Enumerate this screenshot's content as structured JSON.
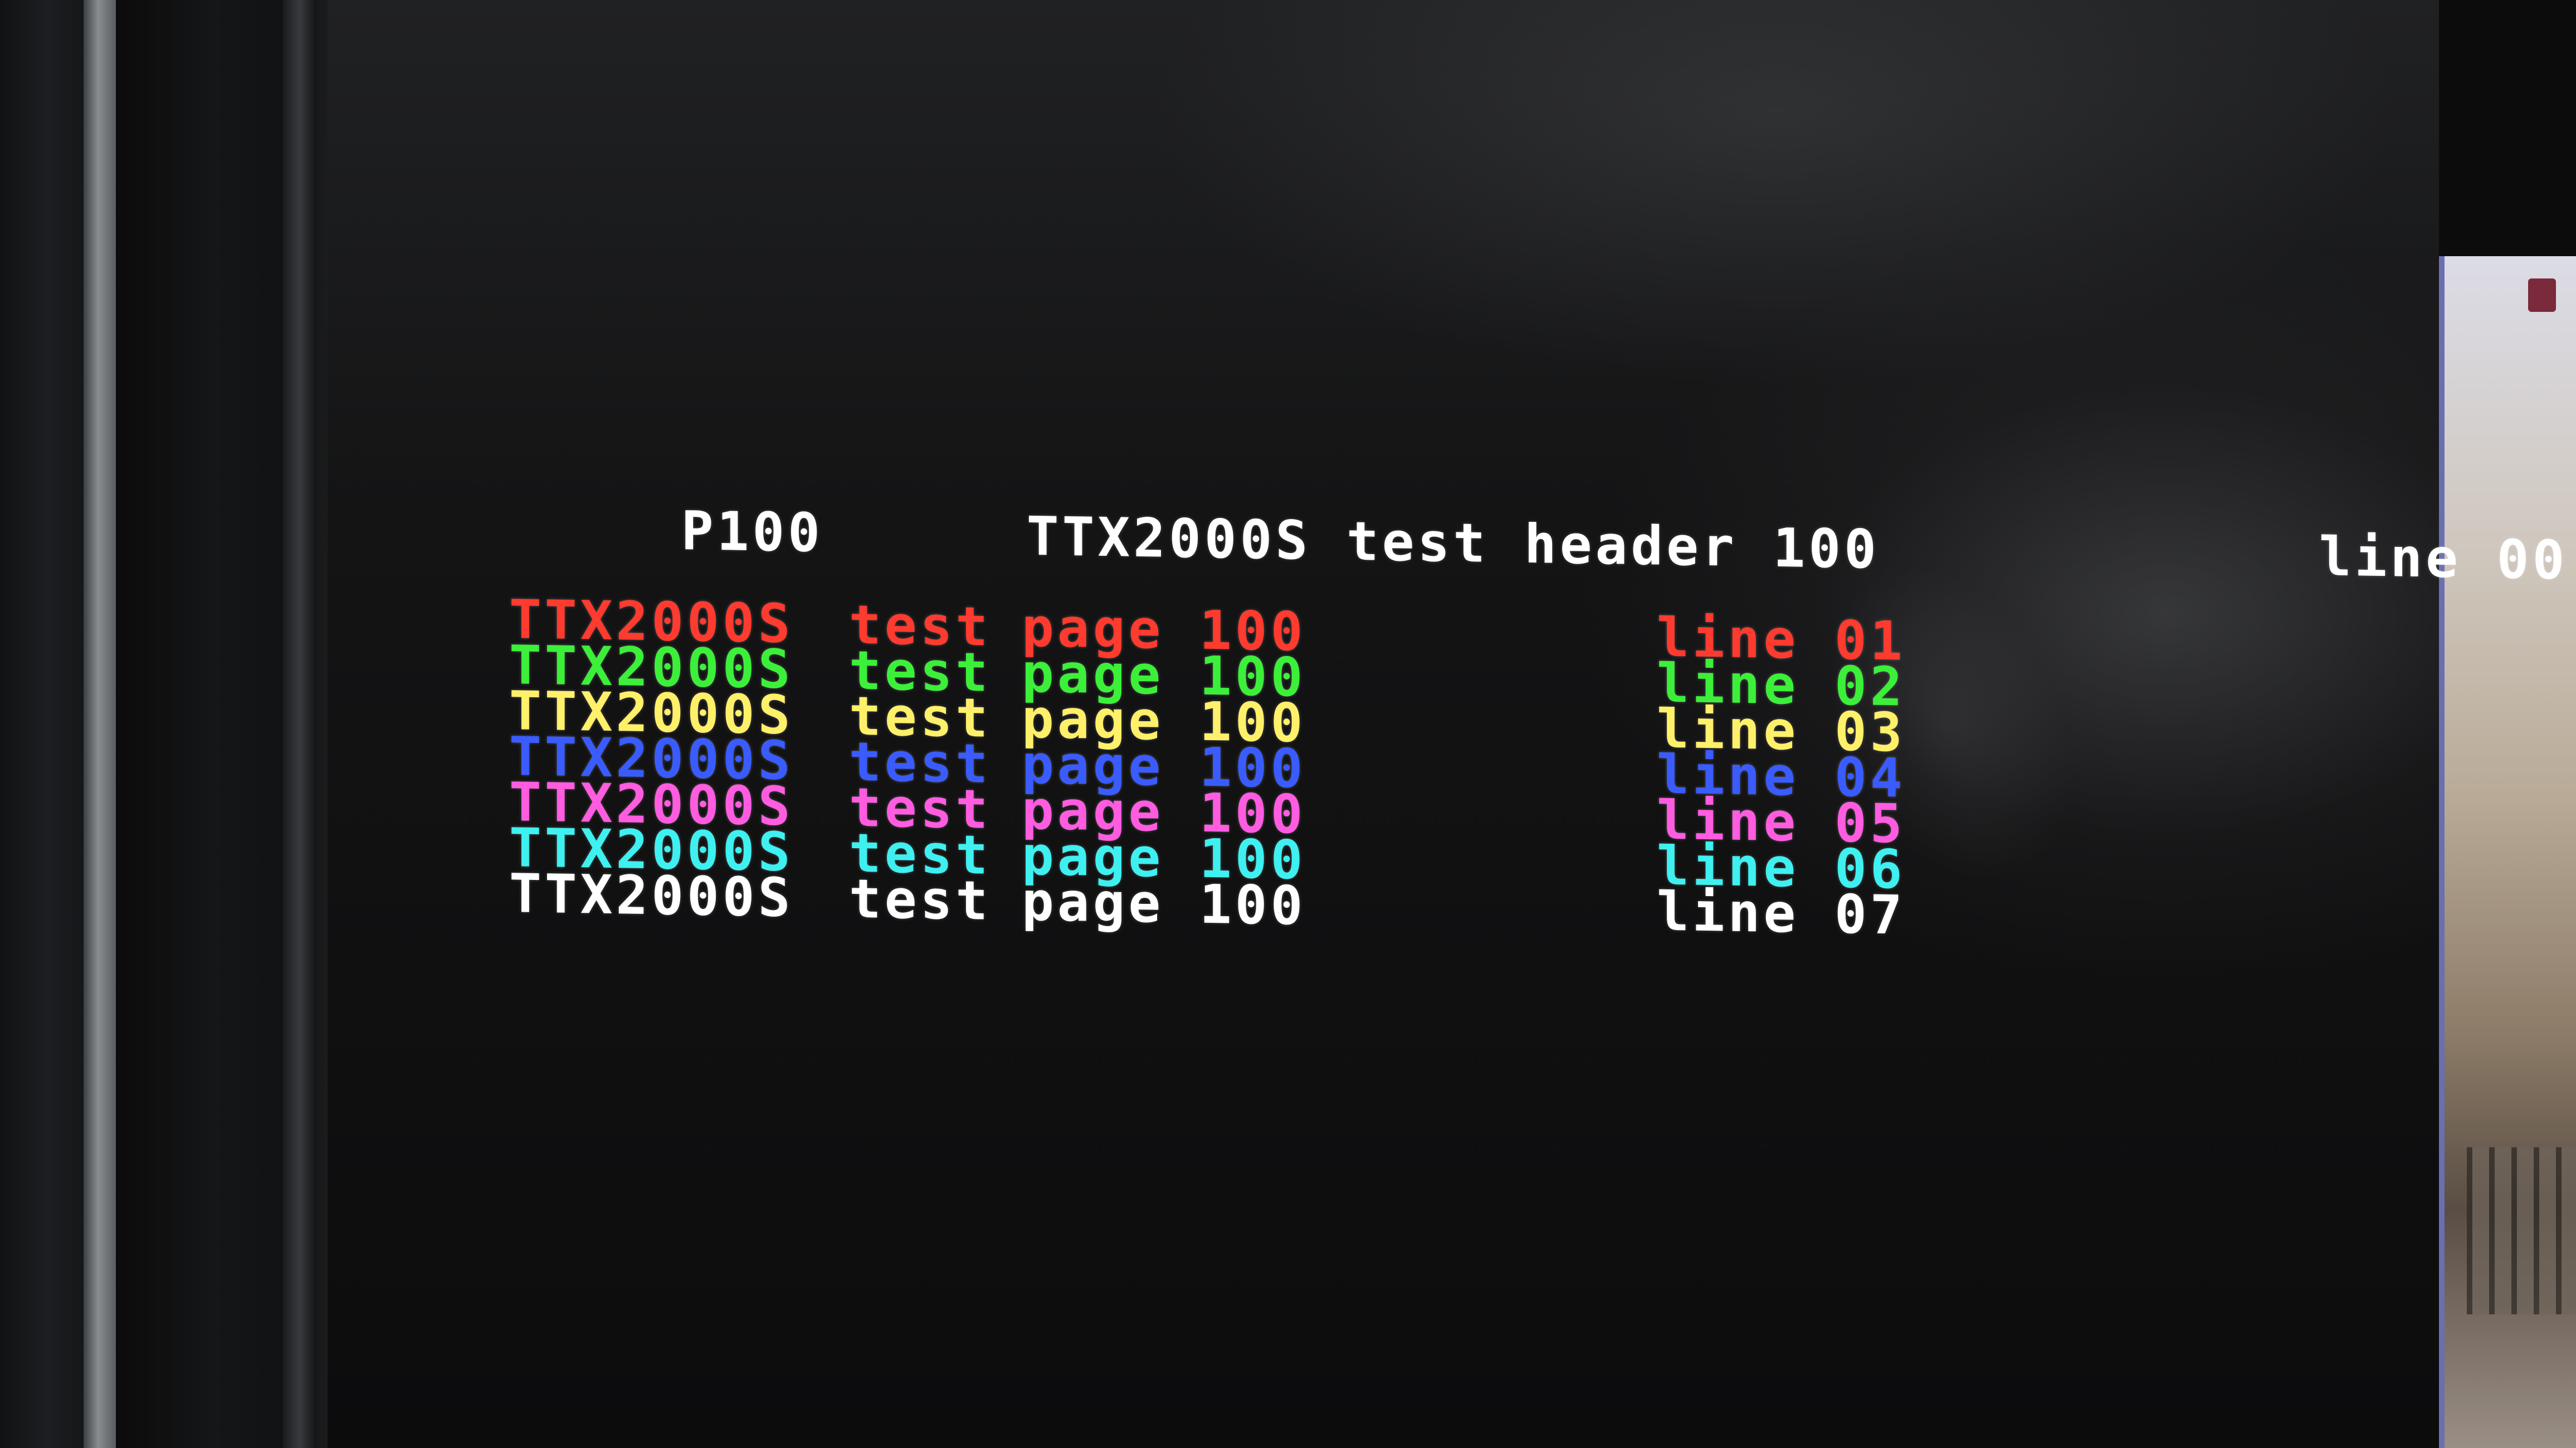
{
  "teletext": {
    "header": {
      "page_number": "P100",
      "service_text": "TTX2000S test header 100",
      "line_label": "line 00"
    },
    "rows": [
      {
        "title": "TTX2000S",
        "word": "test",
        "page": "page 100",
        "line": "line 01",
        "color": "#ff3b2f"
      },
      {
        "title": "TTX2000S",
        "word": "test",
        "page": "page 100",
        "line": "line 02",
        "color": "#3cf03a"
      },
      {
        "title": "TTX2000S",
        "word": "test",
        "page": "page 100",
        "line": "line 03",
        "color": "#fff06a"
      },
      {
        "title": "TTX2000S",
        "word": "test",
        "page": "page 100",
        "line": "line 04",
        "color": "#3a5cff"
      },
      {
        "title": "TTX2000S",
        "word": "test",
        "page": "page 100",
        "line": "line 05",
        "color": "#ff5ce0"
      },
      {
        "title": "TTX2000S",
        "word": "test",
        "page": "page 100",
        "line": "line 06",
        "color": "#3ff0f0"
      },
      {
        "title": "TTX2000S",
        "word": "test",
        "page": "page 100",
        "line": "line 07",
        "color": "#ffffff"
      }
    ],
    "header_color": "#ffffff"
  }
}
